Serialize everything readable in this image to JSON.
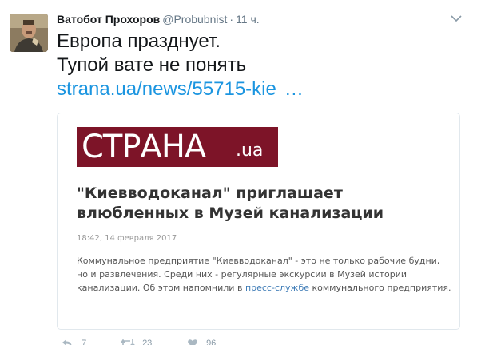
{
  "tweet": {
    "display_name": "Ватобот Прохоров",
    "handle": "@Probubnist",
    "separator": "·",
    "time": "11 ч.",
    "text_lines": [
      "Европа празднует.",
      "Тупой вате не понять"
    ],
    "link_text": "strana.ua/news/55715-kie",
    "link_ellipsis": "…"
  },
  "card": {
    "logo_main": "СТРАНА",
    "logo_suffix": ".ua",
    "headline": "\"Киевводоканал\" приглашает влюбленных в Музей канализации",
    "date": "18:42, 14 февраля 2017",
    "lead_before": "Коммунальное предприятие \"Киевводоканал\" - это не только рабочие будни, но и развлечения. Среди них - регулярные экскурсии в Музей истории канализации. Об этом напомнили в ",
    "lead_link": "пресс-службе",
    "lead_after": " коммунального предприятия."
  },
  "actions": {
    "reply_count": "7",
    "retweet_count": "23",
    "like_count": "96"
  },
  "colors": {
    "link": "#1b95e0",
    "muted": "#657786",
    "logo_bg": "#7d1428",
    "card_border": "#e1e8ed"
  },
  "icons": [
    "caret-down-icon",
    "reply-icon",
    "retweet-icon",
    "heart-icon"
  ]
}
